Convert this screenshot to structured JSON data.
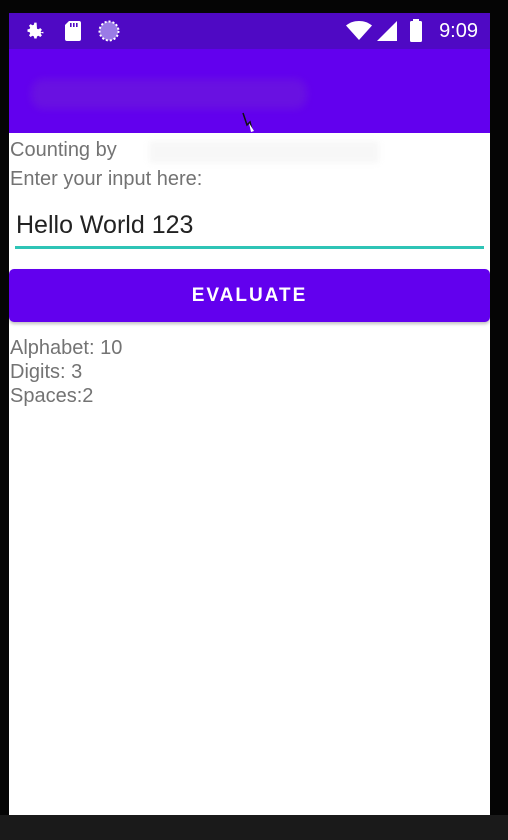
{
  "status_bar": {
    "time": "9:09",
    "icons": [
      "gear-icon",
      "sd-card-icon",
      "sync-icon",
      "wifi-icon",
      "signal-icon",
      "battery-icon"
    ]
  },
  "colors": {
    "status_bar": "#4f09c4",
    "app_bar": "#6200ee",
    "button": "#6200ee",
    "input_underline": "#2ec4b6",
    "label_text": "#737373"
  },
  "main": {
    "counting_label": "Counting  by",
    "input_label": "Enter your input here:",
    "input_value": "Hello World 123",
    "evaluate_label": "EVALUATE",
    "results": {
      "alphabet": "Alphabet: 10",
      "digits": "Digits: 3",
      "spaces": "Spaces:2"
    }
  }
}
